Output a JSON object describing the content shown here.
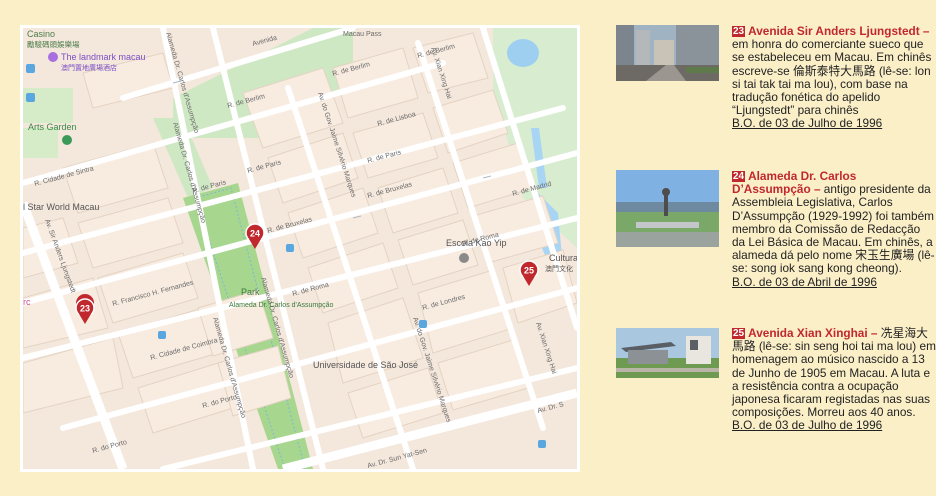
{
  "map": {
    "street_labels": {
      "avenida_top": "Avenida",
      "macau_pass": "Macau Pass",
      "r_berlim_1": "R. de Berlim",
      "r_berlim_2": "R. de Berlim",
      "r_berlim_3": "R. de Berlim",
      "r_lisboa": "R. de Lisboa",
      "r_paris_1": "R. de Paris",
      "r_paris_2": "R. de Paris",
      "r_paris_3": "R. de Paris",
      "r_bruxelas_1": "R. de Bruxelas",
      "r_bruxelas_2": "R. de Bruxelas",
      "r_roma_1": "R. de Roma",
      "r_roma_2": "R. de Roma",
      "r_londres": "R. de Londres",
      "r_madrid": "R. de Madrid",
      "r_cidade_sintra": "R. Cidade de Sintra",
      "r_francisco": "R. Francisco H. Fernandes",
      "r_cidade_coimbra": "R. Cidade de Coimbra",
      "r_porto_1": "R. do Porto",
      "r_porto_2": "R. do Porto",
      "alameda_1": "Alameda Dr. Carlos d'Assumpção",
      "alameda_2": "Alameda Dr. Carlos d'Assumpção",
      "alameda_3": "Alameda Dr. Carlos d'Assumpção",
      "alameda_4": "Alameda Dr. Carlos d'Assumpção",
      "av_sir_anders": "Av. Sir Anders Ljungstedt",
      "av_gov_1": "Av. do Gov. Jaime Silvério Marques",
      "av_gov_2": "Av. do Gov. Jaime Silvério Marques",
      "av_xian_1": "Av. Xian Xing Hai",
      "av_xian_2": "Av. Xian Xing Hai",
      "av_dr_s": "Av. Dr. S",
      "av_sun": "Av. Dr. Sun Yat-Sen"
    },
    "pois": {
      "casino": "Casino",
      "casino_cn": "勵駿碼頭娛樂場",
      "landmark": "The landmark macau",
      "landmark_cn": "澳門置地廣場酒店",
      "arts_garden": "Arts Garden",
      "star_world": "l Star World Macau",
      "escola": "Escola Kao Yip",
      "cultura": "Cultura",
      "cultura_cn": "澳門文化",
      "park": "Park",
      "park_sub": "Alameda Dr. Carlos d'Assumpção",
      "universidade": "Universidade de São José",
      "rc": "rc"
    },
    "markers": [
      "23",
      "24",
      "25"
    ]
  },
  "entries": [
    {
      "number": "23",
      "title": "Avenida Sir Anders Ljungstedt –",
      "body": " em honra do comerciante sueco que se estabeleceu em Macau. Em chinês escreve-se 倫斯泰特大馬路 (lê-se: lon si tai tak tai ma lou), com base na tradução fonética do apelido “Ljungstedt” para chinês",
      "bo": "B.O. de 03 de Julho de 1996"
    },
    {
      "number": "24",
      "title": "Alameda Dr. Carlos D’Assumpção –",
      "body": " antigo presidente da Assembleia Legislativa, Carlos D’Assumpção (1929-1992) foi também membro da Comissão de Redacção da Lei Básica de Macau. Em chinês, a alameda dá pelo nome 宋玉生廣場 (lê-se: song iok sang kong cheong).",
      "bo": "B.O. de 03 de Abril de 1996"
    },
    {
      "number": "25",
      "title": "Avenida Xian Xinghai –",
      "body": " 冼星海大馬路 (lê-se: sin seng hoi tai ma lou) em homenagem ao músico nascido a 13 de Junho de 1905 em Macau. A luta e a resistência contra a ocupação japonesa ficaram registadas nas suas composições. Morreu aos 40 anos.",
      "bo": "B.O. de 03 de Julho de 1996"
    }
  ]
}
